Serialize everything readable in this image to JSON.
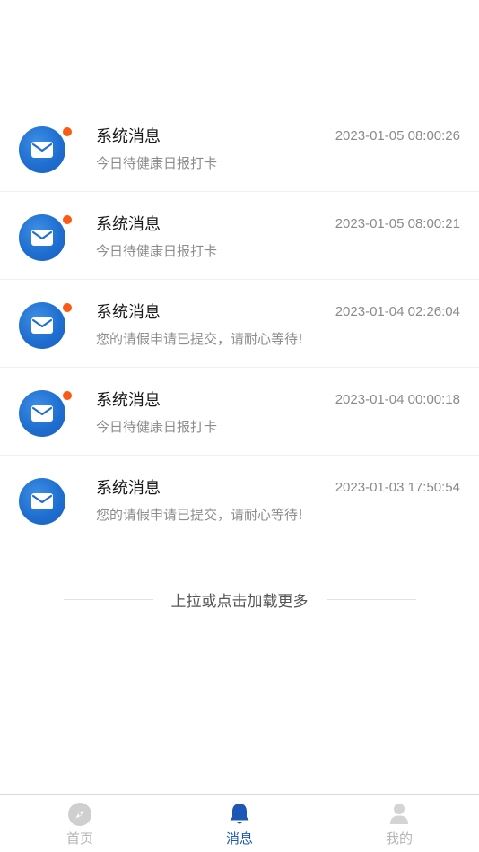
{
  "messages": [
    {
      "title": "系统消息",
      "time": "2023-01-05 08:00:26",
      "body": "今日待健康日报打卡",
      "unread": true
    },
    {
      "title": "系统消息",
      "time": "2023-01-05 08:00:21",
      "body": "今日待健康日报打卡",
      "unread": true
    },
    {
      "title": "系统消息",
      "time": "2023-01-04 02:26:04",
      "body": "您的请假申请已提交，请耐心等待!",
      "unread": true
    },
    {
      "title": "系统消息",
      "time": "2023-01-04 00:00:18",
      "body": "今日待健康日报打卡",
      "unread": true
    },
    {
      "title": "系统消息",
      "time": "2023-01-03 17:50:54",
      "body": "您的请假申请已提交，请耐心等待!",
      "unread": false
    }
  ],
  "load_more": {
    "text": "上拉或点击加载更多"
  },
  "tabs": [
    {
      "label": "首页",
      "icon": "compass-icon",
      "active": false
    },
    {
      "label": "消息",
      "icon": "bell-icon",
      "active": true
    },
    {
      "label": "我的",
      "icon": "user-icon",
      "active": false
    }
  ],
  "colors": {
    "accent": "#1d57b6",
    "avatar_blue": "#1e6fd0",
    "unread_dot": "#fa5a14",
    "inactive_tab": "#b5b5b5"
  }
}
